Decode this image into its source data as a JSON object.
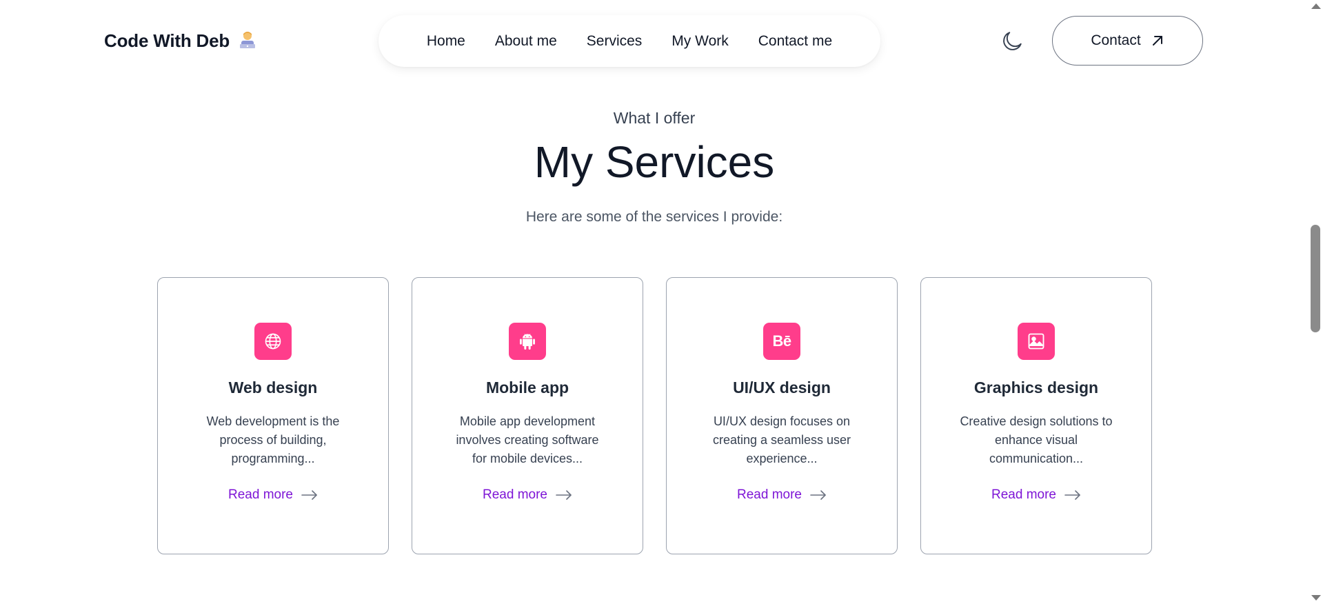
{
  "header": {
    "logo_text": "Code With Deb",
    "logo_emoji_icon": "technologist-emoji-icon",
    "nav": [
      {
        "label": "Home"
      },
      {
        "label": "About me"
      },
      {
        "label": "Services"
      },
      {
        "label": "My Work"
      },
      {
        "label": "Contact me"
      }
    ],
    "theme_toggle_icon": "moon-icon",
    "contact_label": "Contact",
    "contact_icon": "arrow-up-right-icon"
  },
  "services_section": {
    "eyebrow": "What I offer",
    "title": "My Services",
    "subtitle": "Here are some of the services I provide:",
    "cards": [
      {
        "icon": "globe-icon",
        "title": "Web design",
        "description": "Web development is the process of building, programming...",
        "link_label": "Read more",
        "link_icon": "arrow-right-icon"
      },
      {
        "icon": "android-icon",
        "title": "Mobile app",
        "description": "Mobile app development involves creating software for mobile devices...",
        "link_label": "Read more",
        "link_icon": "arrow-right-icon"
      },
      {
        "icon": "behance-icon",
        "icon_text": "Bē",
        "title": "UI/UX design",
        "description": "UI/UX design focuses on creating a seamless user experience...",
        "link_label": "Read more",
        "link_icon": "arrow-right-icon"
      },
      {
        "icon": "image-icon",
        "title": "Graphics design",
        "description": "Creative design solutions to enhance visual communication...",
        "link_label": "Read more",
        "link_icon": "arrow-right-icon"
      }
    ]
  },
  "colors": {
    "accent_pink": "#ff3d8b",
    "link_purple": "#7e15d6",
    "text_dark": "#111827"
  }
}
